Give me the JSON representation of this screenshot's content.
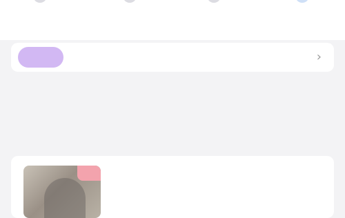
{
  "tabs": [
    {
      "label": "",
      "icon": "tab-icon"
    },
    {
      "label": "",
      "icon": "tab-icon"
    },
    {
      "label": "",
      "icon": "tab-icon"
    },
    {
      "label": "",
      "icon": "tab-icon"
    }
  ],
  "notice": {
    "tag": "",
    "text": "",
    "arrow_icon": "chevron-right-icon"
  },
  "section": {
    "title": "",
    "subtitle": ""
  },
  "card": {
    "badge": "",
    "title": "",
    "meta": [
      "",
      "",
      ""
    ]
  },
  "colors": {
    "background": "#f3f3f5",
    "notice_tag": "#d2b8f3",
    "card_badge": "#f3a3ad",
    "active_tab_icon": "#cfe0f7"
  }
}
